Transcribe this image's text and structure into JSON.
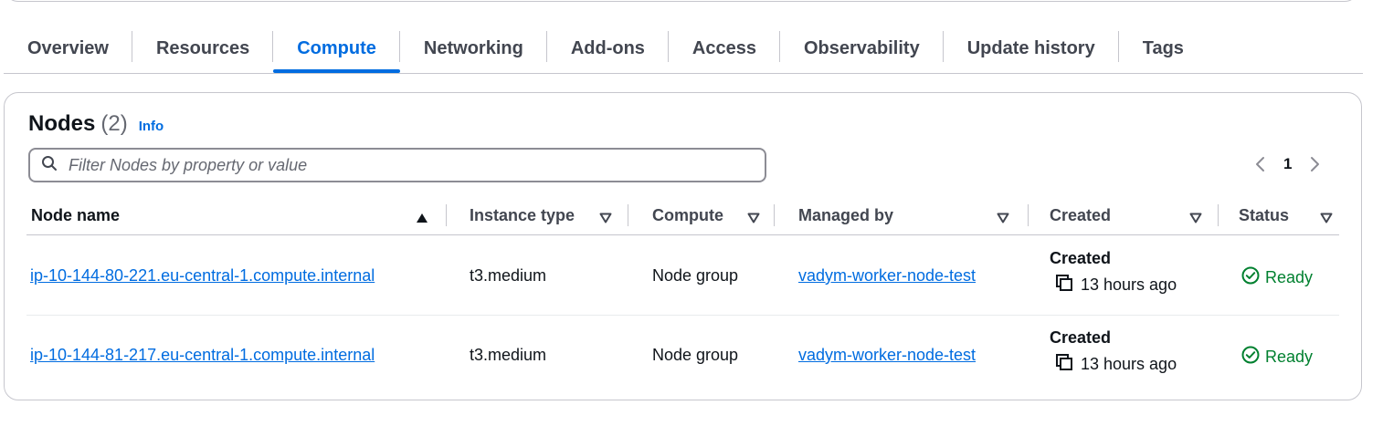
{
  "tabs": [
    {
      "label": "Overview",
      "active": false
    },
    {
      "label": "Resources",
      "active": false
    },
    {
      "label": "Compute",
      "active": true
    },
    {
      "label": "Networking",
      "active": false
    },
    {
      "label": "Add-ons",
      "active": false
    },
    {
      "label": "Access",
      "active": false
    },
    {
      "label": "Observability",
      "active": false
    },
    {
      "label": "Update history",
      "active": false
    },
    {
      "label": "Tags",
      "active": false
    }
  ],
  "nodes": {
    "title": "Nodes",
    "count": "(2)",
    "info_label": "Info",
    "filter_placeholder": "Filter Nodes by property or value",
    "filter_value": "",
    "pagination": {
      "current_page": "1"
    },
    "columns": [
      {
        "label": "Node name",
        "sort": "ascending"
      },
      {
        "label": "Instance type",
        "sort": "none"
      },
      {
        "label": "Compute",
        "sort": "none"
      },
      {
        "label": "Managed by",
        "sort": "none"
      },
      {
        "label": "Created",
        "sort": "none"
      },
      {
        "label": "Status",
        "sort": "none"
      }
    ],
    "rows": [
      {
        "node_name": "ip-10-144-80-221.eu-central-1.compute.internal",
        "instance_type": "t3.medium",
        "compute": "Node group",
        "managed_by": "vadym-worker-node-test",
        "created_label": "Created",
        "created_time": "13 hours ago",
        "status": "Ready"
      },
      {
        "node_name": "ip-10-144-81-217.eu-central-1.compute.internal",
        "instance_type": "t3.medium",
        "compute": "Node group",
        "managed_by": "vadym-worker-node-test",
        "created_label": "Created",
        "created_time": "13 hours ago",
        "status": "Ready"
      }
    ]
  },
  "colors": {
    "accent": "#006ce0",
    "success": "#00802f",
    "border": "#c6c6cd",
    "text": "#0f141a",
    "secondary_text": "#424650"
  },
  "icons": {
    "search": "search-icon",
    "prev_page": "chevron-left-icon",
    "next_page": "chevron-right-icon",
    "sort_asc": "caret-up-filled-icon",
    "sort_none": "caret-down-outline-icon",
    "copy": "copy-icon",
    "status_ok": "status-positive-icon"
  }
}
